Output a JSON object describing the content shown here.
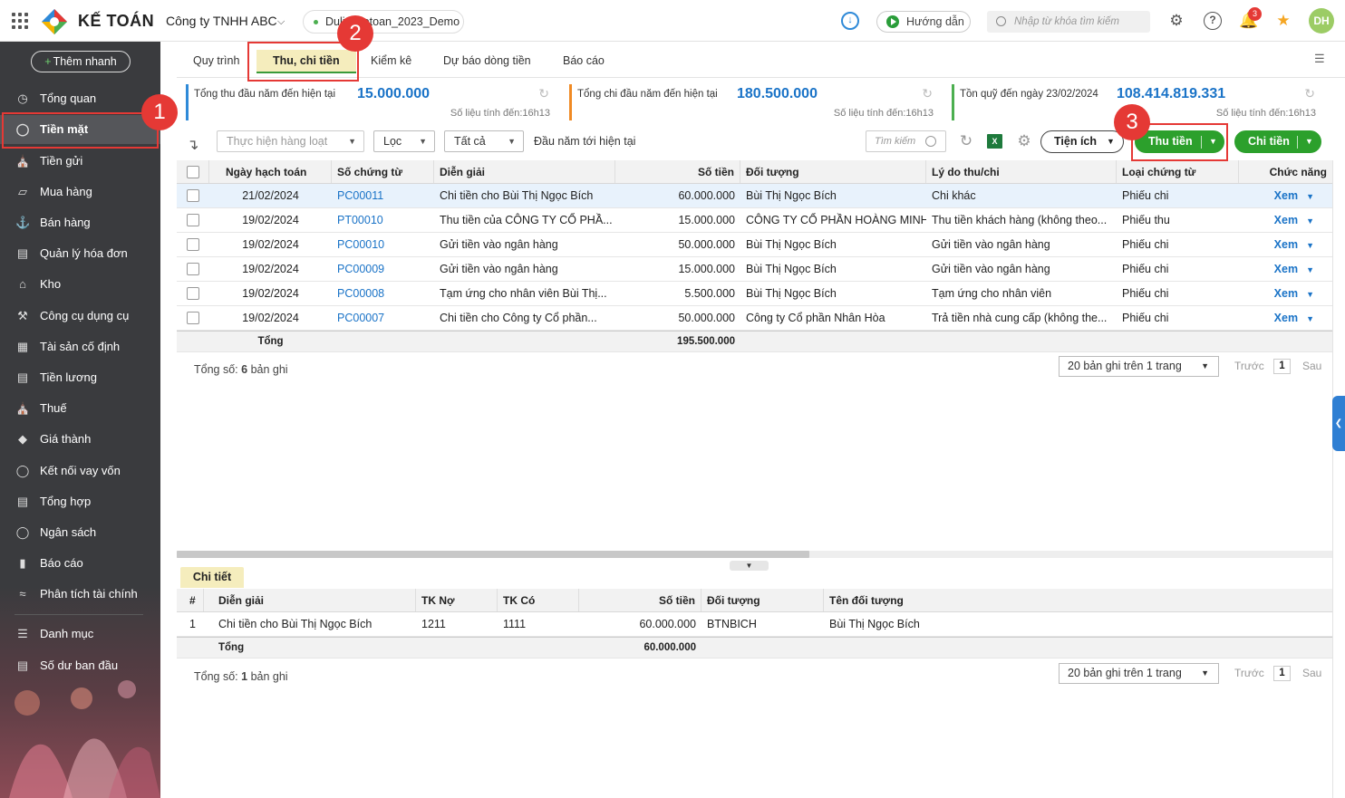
{
  "app": {
    "brand": "KẾ TOÁN",
    "company": "Công ty TNHH ABC",
    "database": "Dulieuketoan_2023_Demo",
    "guide_label": "Hướng dẫn",
    "search_placeholder": "Nhập từ khóa tìm kiếm",
    "notif_count": "3",
    "avatar_initials": "DH"
  },
  "sidebar": {
    "quick_add": "Thêm nhanh",
    "items": [
      {
        "label": "Tổng quan",
        "icon": "dashboard-icon"
      },
      {
        "label": "Tiền mặt",
        "icon": "cash-icon",
        "active": true
      },
      {
        "label": "Tiền gửi",
        "icon": "bank-icon"
      },
      {
        "label": "Mua hàng",
        "icon": "shopping-bag-icon"
      },
      {
        "label": "Bán hàng",
        "icon": "cart-icon"
      },
      {
        "label": "Quản lý hóa đơn",
        "icon": "invoice-icon"
      },
      {
        "label": "Kho",
        "icon": "warehouse-icon"
      },
      {
        "label": "Công cụ dụng cụ",
        "icon": "tools-icon"
      },
      {
        "label": "Tài sản cố định",
        "icon": "asset-icon"
      },
      {
        "label": "Tiền lương",
        "icon": "salary-icon"
      },
      {
        "label": "Thuế",
        "icon": "tax-icon"
      },
      {
        "label": "Giá thành",
        "icon": "price-tag-icon"
      },
      {
        "label": "Kết nối vay vốn",
        "icon": "loan-icon"
      },
      {
        "label": "Tổng hợp",
        "icon": "summary-icon"
      },
      {
        "label": "Ngân sách",
        "icon": "budget-icon"
      },
      {
        "label": "Báo cáo",
        "icon": "bar-chart-icon"
      },
      {
        "label": "Phân tích tài chính",
        "icon": "analytics-icon"
      },
      {
        "label": "Danh mục",
        "icon": "list-icon"
      },
      {
        "label": "Số dư ban đầu",
        "icon": "opening-balance-icon"
      }
    ]
  },
  "tabs": [
    "Quy trình",
    "Thu, chi tiền",
    "Kiểm kê",
    "Dự báo dòng tiền",
    "Báo cáo"
  ],
  "summary": [
    {
      "label": "Tổng thu đầu năm đến hiện tại",
      "value": "15.000.000",
      "sub": "Số liệu tính đến:16h13",
      "color": "#2f8ad8"
    },
    {
      "label": "Tổng chi đầu năm đến hiện tại",
      "value": "180.500.000",
      "sub": "Số liệu tính đến:16h13",
      "color": "#f08a24"
    },
    {
      "label": "Tồn quỹ đến ngày 23/02/2024",
      "value": "108.414.819.331",
      "sub": "Số liệu tính đến:16h13",
      "color": "#4caf50"
    }
  ],
  "toolbar": {
    "batch": "Thực hiện hàng loạt",
    "filter": "Lọc",
    "scope": "Tất cả",
    "period": "Đầu năm tới hiện tại",
    "search": "Tìm kiếm",
    "utilities": "Tiện ích",
    "receive": "Thu tiền",
    "pay": "Chi tiền"
  },
  "grid": {
    "columns": [
      "Ngày hạch toán",
      "Số chứng từ",
      "Diễn giải",
      "Số tiền",
      "Đối tượng",
      "Lý do thu/chi",
      "Loại chứng từ",
      "Chức năng"
    ],
    "rows": [
      [
        "21/02/2024",
        "PC00011",
        "Chi tiền cho Bùi Thị Ngọc Bích",
        "60.000.000",
        "Bùi Thị Ngọc Bích",
        "Chi khác",
        "Phiếu chi",
        "Xem"
      ],
      [
        "19/02/2024",
        "PT00010",
        "Thu tiền của CÔNG TY CỔ PHẦ...",
        "15.000.000",
        "CÔNG TY CỔ PHẦN HOÀNG MINH",
        "Thu tiền khách hàng (không theo...",
        "Phiếu thu",
        "Xem"
      ],
      [
        "19/02/2024",
        "PC00010",
        "Gửi tiền vào ngân hàng",
        "50.000.000",
        "Bùi Thị Ngọc Bích",
        "Gửi tiền vào ngân hàng",
        "Phiếu chi",
        "Xem"
      ],
      [
        "19/02/2024",
        "PC00009",
        "Gửi tiền vào ngân hàng",
        "15.000.000",
        "Bùi Thị Ngọc Bích",
        "Gửi tiền vào ngân hàng",
        "Phiếu chi",
        "Xem"
      ],
      [
        "19/02/2024",
        "PC00008",
        "Tạm ứng cho nhân viên Bùi Thị...",
        "5.500.000",
        "Bùi Thị Ngọc Bích",
        "Tạm ứng cho nhân viên",
        "Phiếu chi",
        "Xem"
      ],
      [
        "19/02/2024",
        "PC00007",
        "Chi tiền cho Công ty Cổ phần...",
        "50.000.000",
        "Công ty Cổ phần Nhân Hòa",
        "Trả tiền nhà cung cấp (không the...",
        "Phiếu chi",
        "Xem"
      ]
    ],
    "total_label": "Tổng",
    "total_amount": "195.500.000",
    "footer_prefix": "Tổng số:",
    "footer_count": "6",
    "footer_suffix": "bản ghi"
  },
  "pager": {
    "size": "20 bản ghi trên 1 trang",
    "prev": "Trước",
    "page": "1",
    "next": "Sau"
  },
  "detail": {
    "tab": "Chi tiết",
    "columns": [
      "#",
      "Diễn giải",
      "TK Nợ",
      "TK Có",
      "Số tiền",
      "Đối tượng",
      "Tên đối tượng"
    ],
    "rows": [
      [
        "1",
        "Chi tiền cho Bùi Thị Ngọc Bích",
        "1211",
        "1111",
        "60.000.000",
        "BTNBICH",
        "Bùi Thị Ngọc Bích"
      ]
    ],
    "total_label": "Tổng",
    "total_amount": "60.000.000",
    "footer_count": "1"
  },
  "callouts": [
    "1",
    "2",
    "3"
  ]
}
